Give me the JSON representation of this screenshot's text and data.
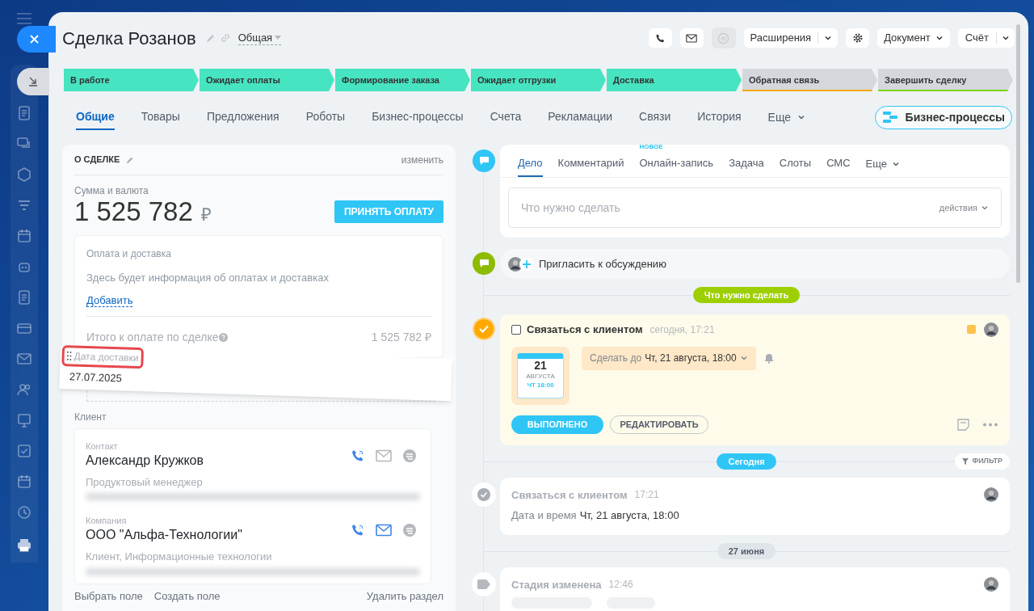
{
  "header": {
    "title": "Сделка Розанов",
    "category": "Общая"
  },
  "toolbar": {
    "extensions": "Расширения",
    "document": "Документ",
    "invoice": "Счёт"
  },
  "stages": [
    {
      "label": "В работе",
      "reached": true,
      "color": "#47e4c2"
    },
    {
      "label": "Ожидает оплаты",
      "reached": true,
      "color": "#47e4c2"
    },
    {
      "label": "Формирование заказа",
      "reached": true,
      "color": "#47e4c2"
    },
    {
      "label": "Ожидает отгрузки",
      "reached": true,
      "color": "#47e4c2"
    },
    {
      "label": "Доставка",
      "reached": true,
      "color": "#47e4c2"
    },
    {
      "label": "Обратная связь",
      "reached": false,
      "color": "#f7a700"
    },
    {
      "label": "Завершить сделку",
      "reached": false,
      "color": "#7bd500"
    }
  ],
  "tabs": [
    {
      "label": "Общие",
      "selected": true
    },
    {
      "label": "Товары",
      "selected": false
    },
    {
      "label": "Предложения",
      "selected": false
    },
    {
      "label": "Роботы",
      "selected": false
    },
    {
      "label": "Бизнес-процессы",
      "selected": false
    },
    {
      "label": "Счета",
      "selected": false
    },
    {
      "label": "Рекламации",
      "selected": false
    },
    {
      "label": "Связи",
      "selected": false
    },
    {
      "label": "История",
      "selected": false
    }
  ],
  "tabs_more": "Еще",
  "bp_button": "Бизнес-процессы",
  "deal": {
    "title": "О СДЕЛКЕ",
    "edit": "изменить",
    "amount_label": "Сумма и валюта",
    "amount": "1 525 782",
    "currency": "₽",
    "pay_button": "ПРИНЯТЬ ОПЛАТУ",
    "payment": {
      "title": "Оплата и доставка",
      "hint": "Здесь будет информация об оплатах и доставках",
      "add": "Добавить",
      "total_label": "Итого к оплате по сделке",
      "total": "1 525 782 ₽"
    },
    "dragged_field": {
      "label": "Дата доставки",
      "value": "27.07.2025"
    },
    "client_label": "Клиент",
    "contacts": [
      {
        "type_label": "Контакт",
        "name": "Александр Кружков",
        "subtitle": "Продуктовый менеджер",
        "email_active": false
      },
      {
        "type_label": "Компания",
        "name": "ООО \"Альфа-Технологии\"",
        "subtitle": "Клиент, Информационные технологии",
        "email_active": true
      }
    ],
    "footer": {
      "choose": "Выбрать поле",
      "create": "Создать поле",
      "delete": "Удалить раздел"
    }
  },
  "timeline": {
    "composer": {
      "tabs": [
        {
          "label": "Дело",
          "selected": true
        },
        {
          "label": "Комментарий",
          "selected": false
        },
        {
          "label": "Онлайн-запись",
          "selected": false,
          "badge": "НОВОЕ"
        },
        {
          "label": "Задача",
          "selected": false
        },
        {
          "label": "Слоты",
          "selected": false
        },
        {
          "label": "СМС",
          "selected": false
        }
      ],
      "more": "Еще",
      "placeholder": "Что нужно сделать",
      "actions": "действия"
    },
    "invite": "Пригласить к обсуждению",
    "entries": [
      {
        "kind": "todo",
        "label": "Что нужно сделать"
      },
      {
        "kind": "task",
        "checked": false,
        "title": "Связаться с клиентом",
        "time": "сегодня, 17:21",
        "calendar": {
          "day": "21",
          "month": "АВГУСТА",
          "sub": "ЧТ 18:00"
        },
        "deadline_prefix": "Сделать до",
        "deadline": "Чт, 21 августа, 18:00",
        "done_button": "ВЫПОЛНЕНО",
        "edit_button": "РЕДАКТИРОВАТЬ"
      },
      {
        "kind": "today",
        "label": "Сегодня",
        "filter": "ФИЛЬТР"
      },
      {
        "kind": "done",
        "title": "Связаться с клиентом",
        "time": "17:21",
        "detail_label": "Дата и время",
        "detail_value": "Чт, 21 августа, 18:00"
      },
      {
        "kind": "date",
        "label": "27 июня"
      },
      {
        "kind": "stage",
        "title": "Стадия изменена",
        "time": "12:46"
      }
    ]
  }
}
